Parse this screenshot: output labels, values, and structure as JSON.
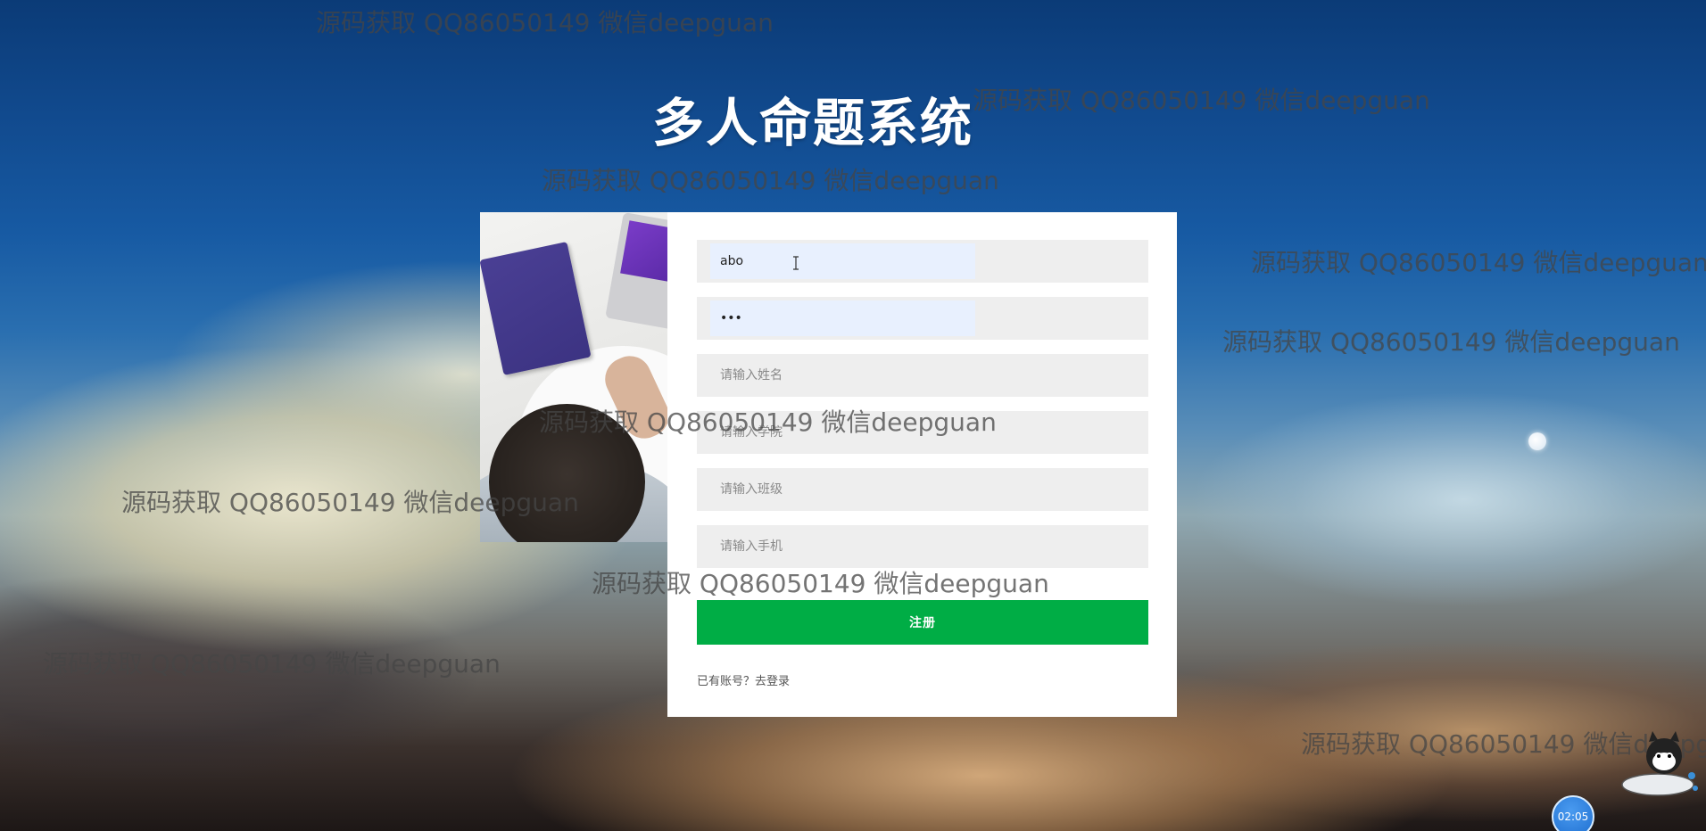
{
  "page": {
    "title": "多人命题系统",
    "watermark_text": "源码获取 QQ86050149 微信deepguan"
  },
  "form": {
    "username": {
      "value": "abo",
      "placeholder": ""
    },
    "password": {
      "value": "•••",
      "placeholder": ""
    },
    "name": {
      "value": "",
      "placeholder": "请输入姓名"
    },
    "college": {
      "value": "",
      "placeholder": "请输入学院"
    },
    "class": {
      "value": "",
      "placeholder": "请输入班级"
    },
    "phone": {
      "value": "",
      "placeholder": "请输入手机"
    },
    "submit_label": "注册",
    "login_link": "已有账号？去登录"
  },
  "widgets": {
    "clock_time": "02:05"
  },
  "colors": {
    "submit_button": "#00ad45",
    "autofill_background": "#e8f0fe",
    "input_background": "#eeeeee",
    "title_text": "#ffffff"
  }
}
